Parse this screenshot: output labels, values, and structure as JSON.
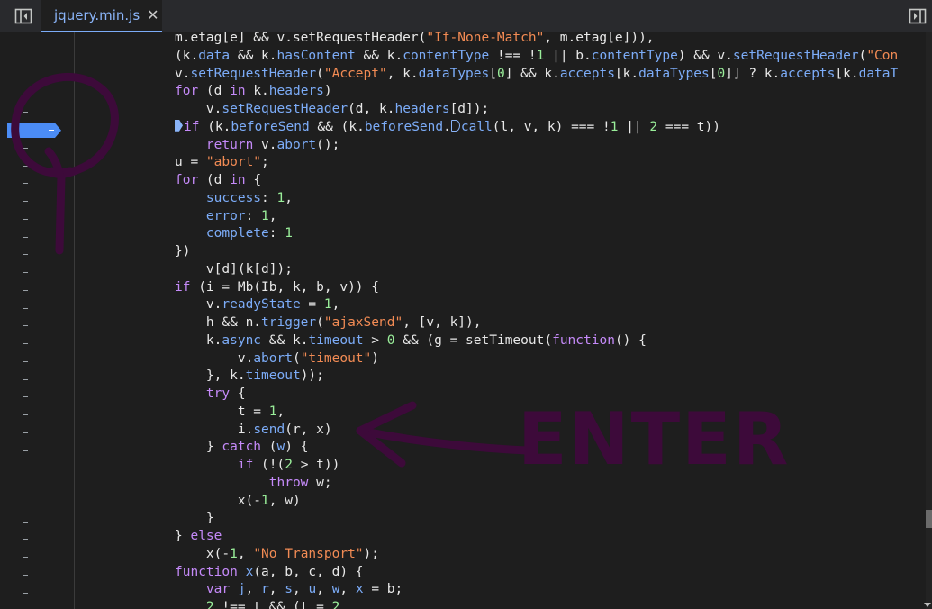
{
  "tabbar": {
    "toggle_navigator_icon": "sidebar-panel-left-icon",
    "file_tab": {
      "label": "jquery.min.js",
      "close_glyph": "✕"
    },
    "toggle_debugger_icon": "sidebar-panel-right-icon",
    "active_tab_color": "#8ab4f8"
  },
  "gutter": {
    "row_count": 32,
    "breakpoint_row": 5,
    "breakpoint_color": "#4b8cf5",
    "marker_glyph": "-"
  },
  "code": {
    "lines": [
      [
        [
          "m.etag[e] && v.setRequestHeader(",
          ""
        ],
        [
          "\"If-None-Match\"",
          "str"
        ],
        [
          ", m.etag[e])),",
          ""
        ]
      ],
      [
        [
          "(k.",
          ""
        ],
        [
          "data",
          "prop"
        ],
        [
          " && k.",
          ""
        ],
        [
          "hasContent",
          "prop"
        ],
        [
          " && k.",
          ""
        ],
        [
          "contentType",
          "prop"
        ],
        [
          " !== !",
          ""
        ],
        [
          "1",
          "num"
        ],
        [
          " || b.",
          ""
        ],
        [
          "contentType",
          "prop"
        ],
        [
          ") && v.",
          ""
        ],
        [
          "setRequestHeader",
          "prop"
        ],
        [
          "(",
          ""
        ],
        [
          "\"Con",
          "str"
        ]
      ],
      [
        [
          "v.",
          ""
        ],
        [
          "setRequestHeader",
          "prop"
        ],
        [
          "(",
          ""
        ],
        [
          "\"Accept\"",
          "str"
        ],
        [
          ", k.",
          ""
        ],
        [
          "dataTypes",
          "prop"
        ],
        [
          "[",
          ""
        ],
        [
          "0",
          "num"
        ],
        [
          "] && k.",
          ""
        ],
        [
          "accepts",
          "prop"
        ],
        [
          "[k.",
          ""
        ],
        [
          "dataTypes",
          "prop"
        ],
        [
          "[",
          ""
        ],
        [
          "0",
          "num"
        ],
        [
          "]] ? k.",
          ""
        ],
        [
          "accepts",
          "prop"
        ],
        [
          "[k.",
          ""
        ],
        [
          "dataT",
          "prop"
        ]
      ],
      [
        [
          "for",
          "kw"
        ],
        [
          " (d ",
          ""
        ],
        [
          "in",
          "kw"
        ],
        [
          " k.",
          ""
        ],
        [
          "headers",
          "prop"
        ],
        [
          ")",
          ""
        ]
      ],
      [
        [
          "    v.",
          ""
        ],
        [
          "setRequestHeader",
          "prop"
        ],
        [
          "(d, k.",
          ""
        ],
        [
          "headers",
          "prop"
        ],
        [
          "[d]);",
          ""
        ]
      ],
      [
        [
          "@pause",
          ""
        ],
        [
          "if",
          "kw"
        ],
        [
          " (k.",
          ""
        ],
        [
          "beforeSend",
          "prop"
        ],
        [
          " && (k.",
          ""
        ],
        [
          "beforeSend",
          "prop"
        ],
        [
          ".",
          ""
        ],
        [
          "@pause-hollow",
          ""
        ],
        [
          "call",
          "prop"
        ],
        [
          "(l, v, k) === !",
          ""
        ],
        [
          "1",
          "num"
        ],
        [
          " || ",
          ""
        ],
        [
          "2",
          "num"
        ],
        [
          " === t))",
          ""
        ]
      ],
      [
        [
          "    ",
          ""
        ],
        [
          "return",
          "kw"
        ],
        [
          " v.",
          ""
        ],
        [
          "abort",
          "prop"
        ],
        [
          "();",
          ""
        ]
      ],
      [
        [
          "u = ",
          ""
        ],
        [
          "\"abort\"",
          "str"
        ],
        [
          ";",
          ""
        ]
      ],
      [
        [
          "for",
          "kw"
        ],
        [
          " (d ",
          ""
        ],
        [
          "in",
          "kw"
        ],
        [
          " {",
          ""
        ]
      ],
      [
        [
          "    ",
          ""
        ],
        [
          "success",
          "prop"
        ],
        [
          ": ",
          ""
        ],
        [
          "1",
          "num"
        ],
        [
          ",",
          ""
        ]
      ],
      [
        [
          "    ",
          ""
        ],
        [
          "error",
          "prop"
        ],
        [
          ": ",
          ""
        ],
        [
          "1",
          "num"
        ],
        [
          ",",
          ""
        ]
      ],
      [
        [
          "    ",
          ""
        ],
        [
          "complete",
          "prop"
        ],
        [
          ": ",
          ""
        ],
        [
          "1",
          "num"
        ]
      ],
      [
        [
          "})",
          ""
        ]
      ],
      [
        [
          "    v[d](k[d]);",
          ""
        ]
      ],
      [
        [
          "if",
          "kw"
        ],
        [
          " (i = Mb(Ib, k, b, v)) {",
          ""
        ]
      ],
      [
        [
          "    v.",
          ""
        ],
        [
          "readyState",
          "prop"
        ],
        [
          " = ",
          ""
        ],
        [
          "1",
          "num"
        ],
        [
          ",",
          ""
        ]
      ],
      [
        [
          "    h && n.",
          ""
        ],
        [
          "trigger",
          "prop"
        ],
        [
          "(",
          ""
        ],
        [
          "\"ajaxSend\"",
          "str"
        ],
        [
          ", [v, k]),",
          ""
        ]
      ],
      [
        [
          "    k.",
          ""
        ],
        [
          "async",
          "prop"
        ],
        [
          " && k.",
          ""
        ],
        [
          "timeout",
          "prop"
        ],
        [
          " > ",
          ""
        ],
        [
          "0",
          "num"
        ],
        [
          " && (g = setTimeout(",
          ""
        ],
        [
          "function",
          "kw"
        ],
        [
          "() {",
          ""
        ]
      ],
      [
        [
          "        v.",
          ""
        ],
        [
          "abort",
          "prop"
        ],
        [
          "(",
          ""
        ],
        [
          "\"timeout\"",
          "str"
        ],
        [
          ")",
          ""
        ]
      ],
      [
        [
          "    }, k.",
          ""
        ],
        [
          "timeout",
          "prop"
        ],
        [
          "));",
          ""
        ]
      ],
      [
        [
          "    ",
          ""
        ],
        [
          "try",
          "kw"
        ],
        [
          " {",
          ""
        ]
      ],
      [
        [
          "        t = ",
          ""
        ],
        [
          "1",
          "num"
        ],
        [
          ",",
          ""
        ]
      ],
      [
        [
          "        i.",
          ""
        ],
        [
          "send",
          "prop"
        ],
        [
          "(r, x)",
          ""
        ]
      ],
      [
        [
          "    } ",
          ""
        ],
        [
          "catch",
          "kw"
        ],
        [
          " (",
          ""
        ],
        [
          "w",
          "prop"
        ],
        [
          ") {",
          ""
        ]
      ],
      [
        [
          "        ",
          ""
        ],
        [
          "if",
          "kw"
        ],
        [
          " (!(",
          ""
        ],
        [
          "2",
          "num"
        ],
        [
          " > t))",
          ""
        ]
      ],
      [
        [
          "            ",
          ""
        ],
        [
          "throw",
          "kw"
        ],
        [
          " w;",
          ""
        ]
      ],
      [
        [
          "        x(-",
          ""
        ],
        [
          "1",
          "num"
        ],
        [
          ", w)",
          ""
        ]
      ],
      [
        [
          "    }",
          ""
        ]
      ],
      [
        [
          "} ",
          ""
        ],
        [
          "else",
          "kw"
        ]
      ],
      [
        [
          "    x(-",
          ""
        ],
        [
          "1",
          "num"
        ],
        [
          ", ",
          ""
        ],
        [
          "\"No Transport\"",
          "str"
        ],
        [
          ");",
          ""
        ]
      ],
      [
        [
          "function",
          "kw"
        ],
        [
          " ",
          ""
        ],
        [
          "x",
          "prop"
        ],
        [
          "(a, b, c, d) {",
          ""
        ]
      ],
      [
        [
          "    ",
          ""
        ],
        [
          "var",
          "kw"
        ],
        [
          " ",
          ""
        ],
        [
          "j",
          "prop"
        ],
        [
          ", ",
          ""
        ],
        [
          "r",
          "prop"
        ],
        [
          ", ",
          ""
        ],
        [
          "s",
          "prop"
        ],
        [
          ", ",
          ""
        ],
        [
          "u",
          "prop"
        ],
        [
          ", ",
          ""
        ],
        [
          "w",
          "prop"
        ],
        [
          ", ",
          ""
        ],
        [
          "x",
          "prop"
        ],
        [
          " = b;",
          ""
        ]
      ],
      [
        [
          "    ",
          ""
        ],
        [
          "2",
          "num"
        ],
        [
          " !== t && (t = ",
          ""
        ],
        [
          "2",
          "num"
        ]
      ]
    ]
  },
  "annotation": {
    "text": "ENTER",
    "ink_color": "#3d0a3a"
  },
  "colors": {
    "background": "#1e1e1e",
    "keyword": "#c58af9",
    "string": "#f28b54",
    "number": "#9aee9a",
    "property": "#7cacf8"
  }
}
